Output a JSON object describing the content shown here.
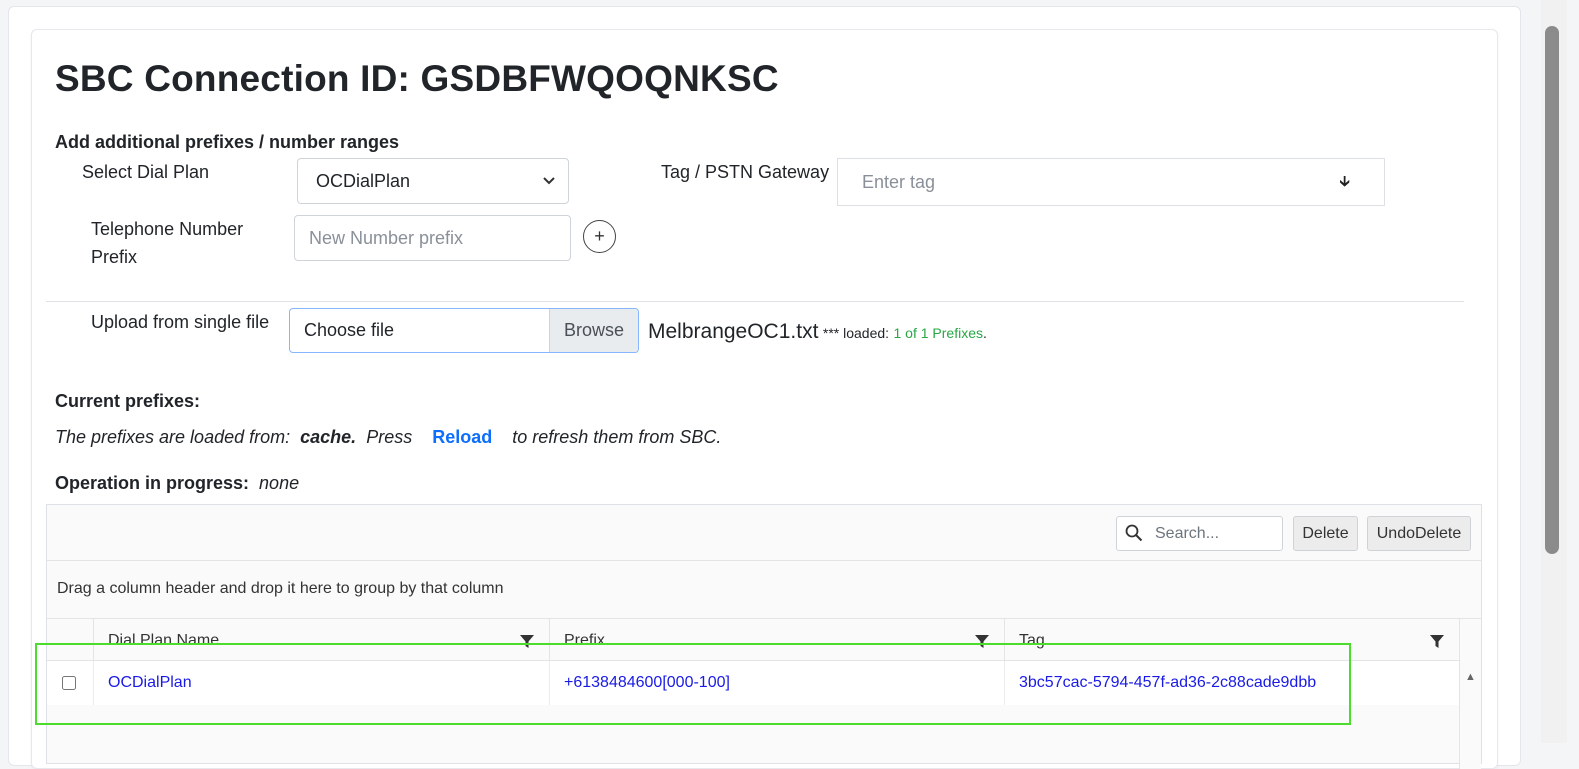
{
  "page": {
    "title": "SBC Connection ID: GSDBFWQOQNKSC"
  },
  "add_section": {
    "heading": "Add additional prefixes / number ranges",
    "dial_plan_label": "Select Dial Plan",
    "dial_plan_value": "OCDialPlan",
    "tag_label": "Tag / PSTN Gateway",
    "tag_placeholder": "Enter tag",
    "phone_label_line1": "Telephone Number",
    "phone_label_line2": "Prefix",
    "phone_placeholder": "New Number prefix",
    "add_button_label": "+",
    "upload_label": "Upload from single file",
    "file_placeholder": "Choose file",
    "browse_label": "Browse",
    "loaded_filename": "MelbrangeOC1.txt",
    "loaded_text": "*** loaded:",
    "loaded_count": "1 of 1 Prefixes",
    "loaded_suffix": "."
  },
  "current": {
    "heading": "Current prefixes:",
    "loaded_from_prefix": "The prefixes are loaded from:",
    "source": "cache.",
    "press": "Press",
    "reload_label": "Reload",
    "refresh_text": "to refresh them from SBC.",
    "operation_label": "Operation in progress:",
    "operation_value": "none"
  },
  "grid": {
    "search_placeholder": "Search...",
    "delete_label": "Delete",
    "undo_delete_label": "UndoDelete",
    "group_hint": "Drag a column header and drop it here to group by that column",
    "columns": [
      "Dial Plan Name",
      "Prefix",
      "Tag"
    ],
    "rows": [
      {
        "dial_plan": "OCDialPlan",
        "prefix": "+6138484600[000-100]",
        "tag": "3bc57cac-5794-457f-ad36-2c88cade9dbb"
      }
    ]
  },
  "colors": {
    "link_blue": "#1a1ae6",
    "reload_blue": "#0d6efd",
    "loaded_green": "#28a745",
    "highlight_green": "#4cdc2c"
  }
}
